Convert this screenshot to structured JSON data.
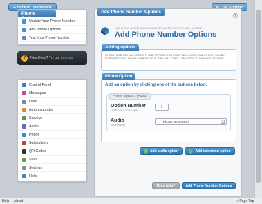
{
  "top_bar": {
    "back_label": "Back to Dashboard",
    "live_support_label": "Live Support"
  },
  "sidebar": {
    "phone_options_title": "Phone Options",
    "phone_items": [
      {
        "label": "Update Your Phone Number",
        "icon": "phone-icon"
      },
      {
        "label": "Add Phone Options",
        "icon": "plus-icon"
      },
      {
        "label": "Test Your Phone Number",
        "icon": "phone-test-icon"
      }
    ],
    "help_text": "Need help? Try our ",
    "help_link": "tutorials",
    "nav_items": [
      {
        "label": "Control Panel",
        "color": "#3d7bc6"
      },
      {
        "label": "Messages",
        "color": "#c94a8c"
      },
      {
        "label": "Lists",
        "color": "#7d8a96"
      },
      {
        "label": "Autoresponder",
        "color": "#d98c2a"
      },
      {
        "label": "Surveys",
        "color": "#4a9e4f"
      },
      {
        "label": "Audio",
        "color": "#5d6fb6"
      },
      {
        "label": "Phone",
        "color": "#3b8ac4"
      },
      {
        "label": "Subscribers",
        "color": "#b9453f"
      },
      {
        "label": "QR Codes",
        "color": "#333333"
      },
      {
        "label": "Stats",
        "color": "#6a9e3a"
      },
      {
        "label": "Settings",
        "color": "#8a8f96"
      },
      {
        "label": "Help",
        "color": "#3b8ac4"
      }
    ]
  },
  "main": {
    "tab_title": "Add Phone Number Options",
    "subtitle": "ADD MENU OPTIONS AND EXTENSIONS TO YOUR PHONE NUMBER",
    "heading": "Add Phone Number Options",
    "adding_options": {
      "title": "Adding options",
      "text": "AT THIS PAGE YOU CAN CREATE PHONE OPTIONS. FOR EXAMPLE IF A USER DIALS 1 THEY CAN BE FORWARDED TO A PHONE NUMBER, OR IF THEY DIAL 2 THEY CAN LISTEN TO AN AUDIO MESSAGE."
    },
    "phone_option_section": {
      "title": "Phone Option",
      "instruction": "Add an option by clicking one of the buttons below.",
      "option_tab": "Phone Option 1 (Audio)",
      "option_number_label": "Option Number",
      "option_number_sub": "USER DIALS TO ACCESS",
      "option_number_value": "1",
      "audio_label": "Audio",
      "audio_sub": "YOUR AUDIO",
      "audio_select": "--- Please Select One ---"
    },
    "add_audio_label": "Add audio option",
    "add_extension_label": "Add extension option",
    "need_help_label": "Need help?",
    "submit_label": "Add Phone Number Options"
  },
  "status_bar": {
    "left": "Help",
    "middle": "About",
    "right": "Page Top"
  }
}
